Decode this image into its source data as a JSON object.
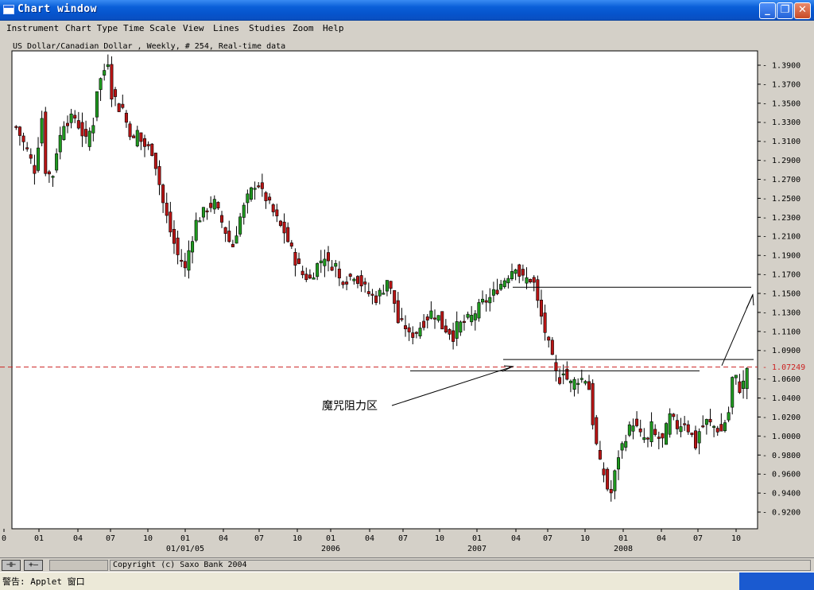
{
  "window": {
    "title": "Chart window",
    "min_glyph": "_",
    "max_glyph": "❐",
    "close_glyph": "✕"
  },
  "menu": [
    "Instrument",
    "Chart Type",
    "Time Scale",
    "View",
    "Lines",
    "Studies",
    "Zoom",
    "Help"
  ],
  "chart_data": {
    "type": "candlestick",
    "title": "US Dollar/Canadian Dollar , Weekly, # 254, Real-time data",
    "ylim": [
      0.9,
      1.41
    ],
    "y_ticks": [
      "1.3900",
      "1.3700",
      "1.3500",
      "1.3300",
      "1.3100",
      "1.2900",
      "1.2700",
      "1.2500",
      "1.2300",
      "1.2100",
      "1.1900",
      "1.1700",
      "1.1500",
      "1.1300",
      "1.1100",
      "1.0900",
      "1.0600",
      "1.0400",
      "1.0200",
      "1.0000",
      "0.9800",
      "0.9600",
      "0.9400",
      "0.9200"
    ],
    "x_ticks": [
      "0",
      "01",
      "04",
      "07",
      "10",
      "01",
      "04",
      "07",
      "10",
      "01",
      "04",
      "07",
      "10",
      "01",
      "04",
      "07",
      "10",
      "01",
      "04",
      "07",
      "10"
    ],
    "year_labels": [
      "01/01/05",
      "2006",
      "2007",
      "2008"
    ],
    "last_price_label": "1.07249",
    "last_price": 1.0725,
    "up_color": "#1f9a1f",
    "down_color": "#b81414",
    "annotation": "魔咒阻力区",
    "path": [
      [
        0,
        1.325
      ],
      [
        3,
        1.3
      ],
      [
        5,
        1.28
      ],
      [
        7,
        1.335
      ],
      [
        8,
        1.28
      ],
      [
        9,
        1.275
      ],
      [
        10,
        1.275
      ],
      [
        11,
        1.3
      ],
      [
        12,
        1.315
      ],
      [
        13,
        1.33
      ],
      [
        16,
        1.335
      ],
      [
        19,
        1.31
      ],
      [
        21,
        1.33
      ],
      [
        22,
        1.365
      ],
      [
        24,
        1.385
      ],
      [
        25,
        1.395
      ],
      [
        26,
        1.36
      ],
      [
        27,
        1.355
      ],
      [
        28,
        1.345
      ],
      [
        29,
        1.345
      ],
      [
        30,
        1.33
      ],
      [
        31,
        1.32
      ],
      [
        32,
        1.31
      ],
      [
        33,
        1.32
      ],
      [
        34,
        1.31
      ],
      [
        35,
        1.305
      ],
      [
        37,
        1.3
      ],
      [
        38,
        1.285
      ],
      [
        40,
        1.245
      ],
      [
        42,
        1.215
      ],
      [
        44,
        1.19
      ],
      [
        45,
        1.185
      ],
      [
        46,
        1.175
      ],
      [
        47,
        1.195
      ],
      [
        49,
        1.225
      ],
      [
        52,
        1.24
      ],
      [
        54,
        1.245
      ],
      [
        56,
        1.225
      ],
      [
        58,
        1.205
      ],
      [
        59,
        1.2
      ],
      [
        61,
        1.23
      ],
      [
        63,
        1.25
      ],
      [
        65,
        1.265
      ],
      [
        66,
        1.265
      ],
      [
        67,
        1.255
      ],
      [
        68,
        1.25
      ],
      [
        70,
        1.235
      ],
      [
        72,
        1.22
      ],
      [
        73,
        1.215
      ],
      [
        74,
        1.205
      ],
      [
        76,
        1.185
      ],
      [
        78,
        1.17
      ],
      [
        80,
        1.165
      ],
      [
        82,
        1.18
      ],
      [
        84,
        1.19
      ],
      [
        85,
        1.18
      ],
      [
        87,
        1.18
      ],
      [
        88,
        1.165
      ],
      [
        90,
        1.165
      ],
      [
        92,
        1.17
      ],
      [
        94,
        1.16
      ],
      [
        96,
        1.15
      ],
      [
        98,
        1.145
      ],
      [
        100,
        1.155
      ],
      [
        101,
        1.165
      ],
      [
        103,
        1.14
      ],
      [
        104,
        1.12
      ],
      [
        106,
        1.115
      ],
      [
        107,
        1.105
      ],
      [
        109,
        1.11
      ],
      [
        111,
        1.12
      ],
      [
        112,
        1.125
      ],
      [
        113,
        1.13
      ],
      [
        115,
        1.125
      ],
      [
        116,
        1.115
      ],
      [
        118,
        1.11
      ],
      [
        119,
        1.105
      ],
      [
        120,
        1.115
      ],
      [
        122,
        1.12
      ],
      [
        124,
        1.125
      ],
      [
        126,
        1.135
      ],
      [
        127,
        1.14
      ],
      [
        129,
        1.145
      ],
      [
        131,
        1.155
      ],
      [
        133,
        1.165
      ],
      [
        135,
        1.175
      ],
      [
        136,
        1.18
      ],
      [
        137,
        1.17
      ],
      [
        138,
        1.165
      ],
      [
        140,
        1.165
      ],
      [
        141,
        1.16
      ],
      [
        142,
        1.14
      ],
      [
        143,
        1.125
      ],
      [
        144,
        1.11
      ],
      [
        145,
        1.095
      ],
      [
        146,
        1.08
      ],
      [
        147,
        1.065
      ],
      [
        148,
        1.06
      ],
      [
        149,
        1.07
      ],
      [
        150,
        1.06
      ],
      [
        151,
        1.055
      ],
      [
        153,
        1.06
      ],
      [
        155,
        1.06
      ],
      [
        156,
        1.05
      ],
      [
        157,
        1.015
      ],
      [
        158,
        0.99
      ],
      [
        159,
        0.97
      ],
      [
        160,
        0.96
      ],
      [
        161,
        0.945
      ],
      [
        162,
        0.94
      ],
      [
        163,
        0.96
      ],
      [
        164,
        0.98
      ],
      [
        166,
        1.0
      ],
      [
        168,
        1.015
      ],
      [
        170,
        1.0
      ],
      [
        172,
        0.995
      ],
      [
        173,
        1.01
      ],
      [
        174,
        1.0
      ],
      [
        176,
        0.995
      ],
      [
        178,
        1.02
      ],
      [
        180,
        1.01
      ],
      [
        182,
        1.015
      ],
      [
        184,
        1.0
      ],
      [
        185,
        0.99
      ],
      [
        186,
        1.005
      ],
      [
        188,
        1.015
      ],
      [
        190,
        1.01
      ],
      [
        192,
        1.005
      ],
      [
        193,
        1.015
      ],
      [
        194,
        1.025
      ],
      [
        195,
        1.06
      ],
      [
        196,
        1.06
      ],
      [
        197,
        1.05
      ],
      [
        198,
        1.055
      ],
      [
        199,
        1.072
      ]
    ],
    "bars_count": 200
  },
  "status": {
    "btn1": "⊣⊢",
    "btn2": "+—",
    "copyright": "Copyright (c) Saxo Bank 2004"
  },
  "warning": "警告: Applet 窗口"
}
